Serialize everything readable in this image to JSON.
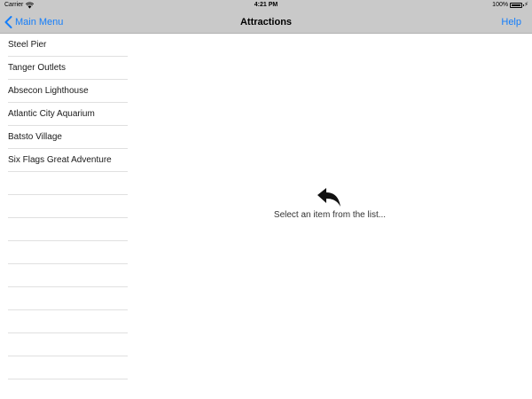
{
  "status": {
    "carrier": "Carrier",
    "time": "4:21 PM",
    "battery": "100%",
    "icons": [
      "wifi-icon",
      "battery-icon",
      "bolt-icon"
    ]
  },
  "nav": {
    "back_label": "Main Menu",
    "title": "Attractions",
    "help_label": "Help",
    "accent_color": "#147efb",
    "bar_color": "#c9c9c9"
  },
  "list": {
    "items": [
      {
        "label": "Steel Pier"
      },
      {
        "label": "Tanger Outlets"
      },
      {
        "label": "Absecon Lighthouse"
      },
      {
        "label": "Atlantic City Aquarium"
      },
      {
        "label": "Batsto Village"
      },
      {
        "label": "Six Flags Great Adventure"
      },
      {
        "label": ""
      },
      {
        "label": ""
      },
      {
        "label": ""
      },
      {
        "label": ""
      },
      {
        "label": ""
      },
      {
        "label": ""
      },
      {
        "label": ""
      },
      {
        "label": ""
      },
      {
        "label": ""
      },
      {
        "label": ""
      }
    ]
  },
  "detail": {
    "icon": "undo-arrow-icon",
    "placeholder": "Select an item from the list..."
  }
}
